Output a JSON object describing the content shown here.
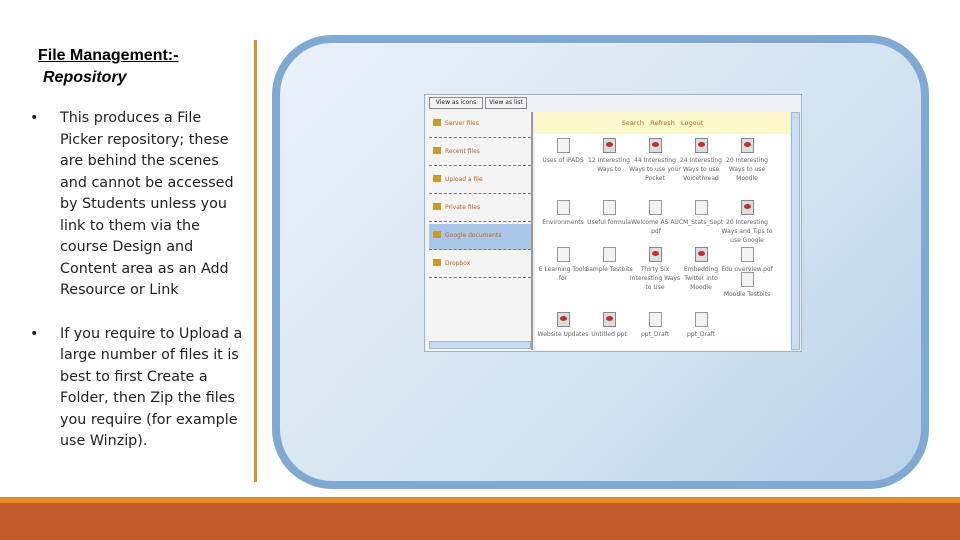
{
  "title": {
    "line1": "File Management:-",
    "line2": "Repository"
  },
  "bullets": [
    "This produces a File Picker repository; these are behind the scenes and cannot be accessed by Students unless you link to them via the course Design and Content area as an Add Resource or Link",
    "If you require to Upload a large number of files it is best to first Create a Folder, then Zip the files you require (for example use Winzip)."
  ],
  "screenshot": {
    "toolbar": [
      "View as icons",
      "View as list"
    ],
    "sidebar": [
      "Server files",
      "Recent files",
      "Upload a file",
      "Private files",
      "Google documents",
      "Dropbox"
    ],
    "selected_sidebar": "Google documents",
    "actions": [
      "Search",
      "Refresh",
      "Logout"
    ],
    "files": [
      {
        "name": "Uses of iPADS",
        "icon": "doc"
      },
      {
        "name": "12 Interesting Ways to",
        "icon": "ppt"
      },
      {
        "name": "44 Interesting Ways to use your Pocket",
        "icon": "ppt"
      },
      {
        "name": "24 Interesting Ways to use Voicethread",
        "icon": "ppt"
      },
      {
        "name": "20 Interesting Ways to use Moodle",
        "icon": "ppt"
      },
      {
        "name": "Environments",
        "icon": "sheet"
      },
      {
        "name": "Useful formula",
        "icon": "sheet"
      },
      {
        "name": "Welcome AS AU .pdf",
        "icon": "doc"
      },
      {
        "name": "CM_Stats_Sept",
        "icon": "pdf"
      },
      {
        "name": "20 Interesting Ways and Tips to use Google",
        "icon": "ppt"
      },
      {
        "name": "E Learning Tools for",
        "icon": "doc"
      },
      {
        "name": "Sample Testbits",
        "icon": "sheet"
      },
      {
        "name": "Thirty Six Interesting Ways to Use",
        "icon": "ppt"
      },
      {
        "name": "Embedding Twitter into Moodle",
        "icon": "ppt"
      },
      {
        "name": "Edu overview.pdf",
        "icon": "pdf"
      },
      {
        "name": "Moodle Testbits",
        "icon": "sheet"
      },
      {
        "name": "Website Updates",
        "icon": "ppt"
      },
      {
        "name": "Untitled ppt",
        "icon": "ppt"
      },
      {
        "name": "ppt_Draft",
        "icon": "doc"
      },
      {
        "name": "ppt_Draft",
        "icon": "doc"
      }
    ]
  },
  "colors": {
    "accent_orange": "#e58a24",
    "footer": "#c0582b",
    "frame": "#7fa9d1"
  }
}
